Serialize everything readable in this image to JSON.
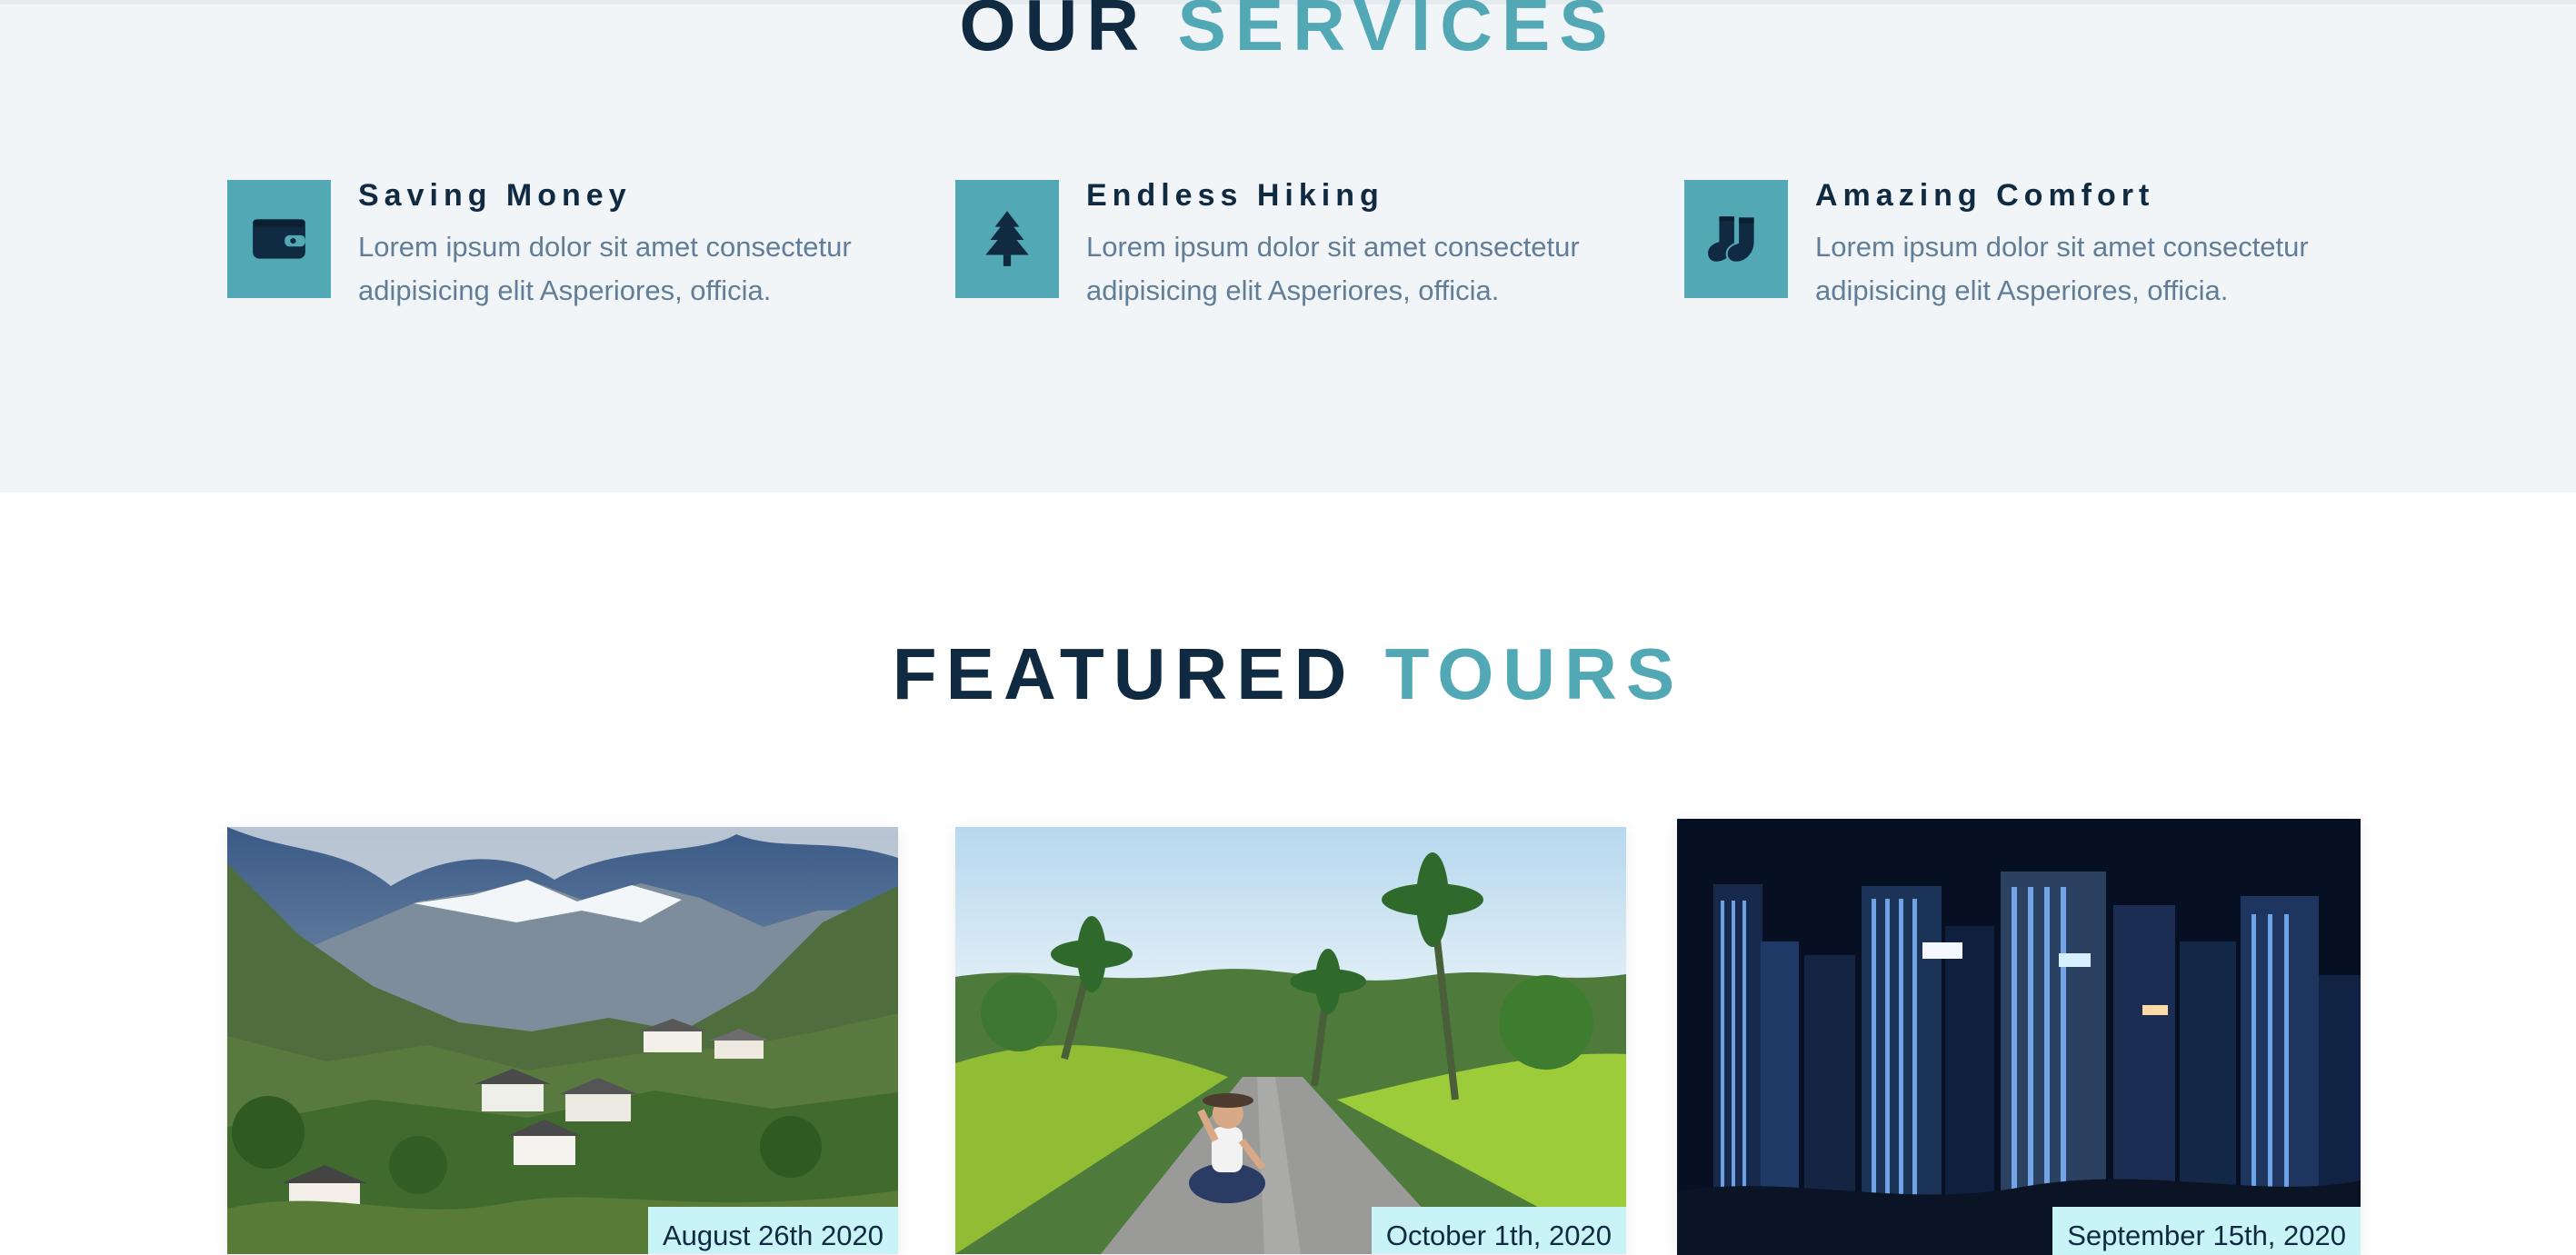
{
  "services": {
    "title_dark": "OUR",
    "title_accent": "SERVICES",
    "items": [
      {
        "icon": "wallet-icon",
        "title": "Saving Money",
        "text": "Lorem ipsum dolor sit amet consectetur adipisicing elit Asperiores, officia."
      },
      {
        "icon": "tree-icon",
        "title": "Endless Hiking",
        "text": "Lorem ipsum dolor sit amet consectetur adipisicing elit Asperiores, officia."
      },
      {
        "icon": "socks-icon",
        "title": "Amazing Comfort",
        "text": "Lorem ipsum dolor sit amet consectetur adipisicing elit Asperiores, officia."
      }
    ]
  },
  "tours": {
    "title_dark": "FEATURED",
    "title_accent": "TOURS",
    "items": [
      {
        "image": "mountain-village-photo",
        "date": "August 26th 2020"
      },
      {
        "image": "tropical-road-photo",
        "date": "October 1th, 2020"
      },
      {
        "image": "night-city-photo",
        "date": "September 15th, 2020"
      }
    ]
  },
  "colors": {
    "primary": "#102a42",
    "accent": "#53a8b6",
    "services_background": "#f1f5f8",
    "body_text": "#617d98",
    "date_badge": "#c8f4f8"
  }
}
